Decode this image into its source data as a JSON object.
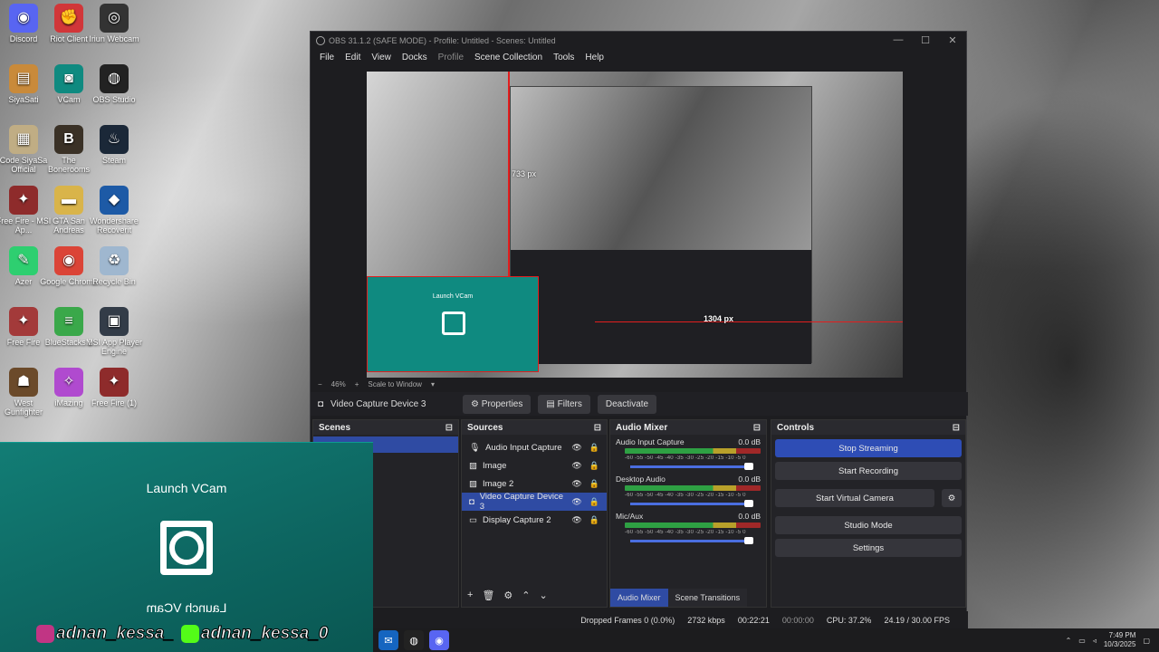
{
  "desktop_icons": [
    {
      "label": "Discord",
      "icon": "discord-icon",
      "color": "#5865f2",
      "glyph": "◉"
    },
    {
      "label": "Riot Client",
      "icon": "riot-icon",
      "color": "#d13639",
      "glyph": "✊"
    },
    {
      "label": "Iriun Webcam",
      "icon": "webcam-icon",
      "color": "#333333",
      "glyph": "◎"
    },
    {
      "label": "SiyaSati",
      "icon": "app-icon",
      "color": "#c98a3a",
      "glyph": "▤"
    },
    {
      "label": "VCam",
      "icon": "vcam-icon",
      "color": "#0f8a80",
      "glyph": "◙"
    },
    {
      "label": "OBS Studio",
      "icon": "obs-icon",
      "color": "#222222",
      "glyph": "◍"
    },
    {
      "label": "Code SiyaSa Official",
      "icon": "code-icon",
      "color": "#c0ad84",
      "glyph": "▦"
    },
    {
      "label": "The Bonerooms",
      "icon": "game-icon",
      "color": "#3a3126",
      "glyph": "B"
    },
    {
      "label": "Steam",
      "icon": "steam-icon",
      "color": "#1b2838",
      "glyph": "♨"
    },
    {
      "label": "Free Fire - MSI Ap...",
      "icon": "freefire-icon",
      "color": "#8e2b2b",
      "glyph": "✦"
    },
    {
      "label": "GTA San Andreas",
      "icon": "folder-icon",
      "color": "#d9b44a",
      "glyph": "▬"
    },
    {
      "label": "Wondershare Recoverit",
      "icon": "recoverit-icon",
      "color": "#1d5aa6",
      "glyph": "◆"
    },
    {
      "label": "Azer",
      "icon": "azer-icon",
      "color": "#2ecf70",
      "glyph": "✎"
    },
    {
      "label": "Google Chrome",
      "icon": "chrome-icon",
      "color": "#db4437",
      "glyph": "◉"
    },
    {
      "label": "Recycle Bin",
      "icon": "recycle-bin-icon",
      "color": "#9fb7cf",
      "glyph": "♻"
    },
    {
      "label": "Free Fire",
      "icon": "freefire-icon",
      "color": "#a33a3a",
      "glyph": "✦"
    },
    {
      "label": "BlueStacks 5",
      "icon": "bluestacks-icon",
      "color": "#3aa84a",
      "glyph": "≡"
    },
    {
      "label": "MSI App Player Engine",
      "icon": "msi-icon",
      "color": "#333c48",
      "glyph": "▣"
    },
    {
      "label": "West Gunfighter",
      "icon": "game-icon",
      "color": "#6b4a2a",
      "glyph": "☗"
    },
    {
      "label": "iMazing",
      "icon": "imazing-icon",
      "color": "#b04acf",
      "glyph": "✧"
    },
    {
      "label": "Free Fire (1)",
      "icon": "freefire-icon",
      "color": "#8e2b2b",
      "glyph": "✦"
    }
  ],
  "obs": {
    "title": "OBS 31.1.2 (SAFE MODE) - Profile: Untitled - Scenes: Untitled",
    "menu": [
      "File",
      "Edit",
      "View",
      "Docks",
      "Profile",
      "Scene Collection",
      "Tools",
      "Help"
    ],
    "preview": {
      "zoom": "46%",
      "scale": "Scale to Window",
      "measure_v": "733 px",
      "measure_h": "1304 px",
      "mini_launch": "Launch VCam"
    },
    "source_bar": {
      "name": "Video Capture Device 3",
      "properties": "Properties",
      "filters": "Filters",
      "deactivate": "Deactivate"
    },
    "docks": {
      "scenes": "Scenes",
      "sources": "Sources",
      "mixer": "Audio Mixer",
      "controls": "Controls"
    },
    "sources": [
      {
        "name": "Audio Input Capture",
        "icon": "microphone-icon",
        "glyph": "🎙"
      },
      {
        "name": "Image",
        "icon": "image-icon",
        "glyph": "▨"
      },
      {
        "name": "Image 2",
        "icon": "image-icon",
        "glyph": "▨"
      },
      {
        "name": "Video Capture Device 3",
        "icon": "camera-icon",
        "glyph": "◘"
      },
      {
        "name": "Display Capture 2",
        "icon": "monitor-icon",
        "glyph": "▭"
      }
    ],
    "mixer": [
      {
        "name": "Audio Input Capture",
        "db": "0.0 dB"
      },
      {
        "name": "Desktop Audio",
        "db": "0.0 dB"
      },
      {
        "name": "Mic/Aux",
        "db": "0.0 dB"
      }
    ],
    "meter_ticks": "-60 -55 -50 -45 -40 -35 -30 -25 -20 -15 -10 -5 0",
    "mixer_tabs": [
      "Audio Mixer",
      "Scene Transitions"
    ],
    "controls": [
      "Stop Streaming",
      "Start Recording",
      "Start Virtual Camera",
      "Studio Mode",
      "Settings"
    ],
    "status": {
      "dropped": "Dropped Frames 0 (0.0%)",
      "bitrate": "2732 kbps",
      "live": "00:22:21",
      "rec": "00:00:00",
      "cpu": "CPU: 37.2%",
      "fps": "24.19 / 30.00 FPS"
    }
  },
  "vcam": {
    "top": "Launch VCam",
    "bottom": "Launch VCam",
    "handle1": "adnan_kessa_",
    "handle2": "adnan_kessa_0",
    "ig_color": "#c13584",
    "kick_color": "#53fc18"
  },
  "taskbar": {
    "time": "7:49 PM",
    "date": "10/3/2025"
  }
}
